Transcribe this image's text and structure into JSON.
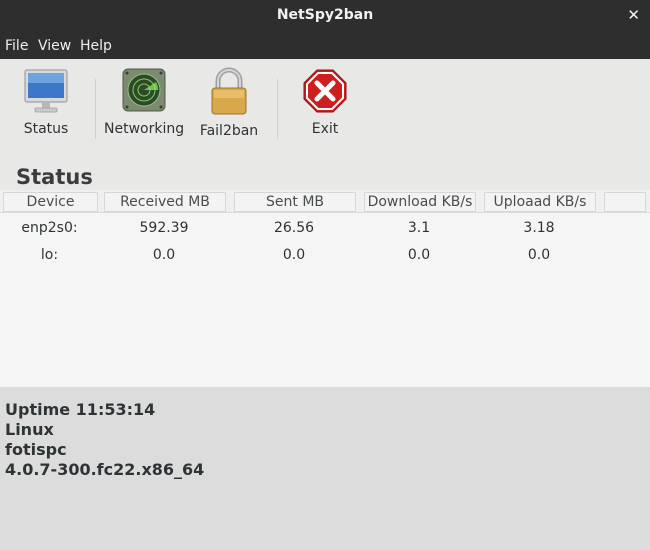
{
  "window": {
    "title": "NetSpy2ban",
    "close_glyph": "✕"
  },
  "menu": [
    "File",
    "View",
    "Help"
  ],
  "toolbar": {
    "status": "Status",
    "networking": "Networking",
    "fail2ban": "Fail2ban",
    "exit": "Exit"
  },
  "section_title": "Status",
  "table": {
    "headers": [
      "Device",
      "Received MB",
      "Sent MB",
      "Download KB/s",
      "Uploaad KB/s",
      ""
    ],
    "rows": [
      [
        "enp2s0:",
        "592.39",
        "26.56",
        "3.1",
        "3.18"
      ],
      [
        "lo:",
        "0.0",
        "0.0",
        "0.0",
        "0.0"
      ]
    ]
  },
  "info": {
    "uptime": "Uptime 11:53:14",
    "os": "Linux",
    "hostname": "fotispc",
    "kernel": "4.0.7-300.fc22.x86_64"
  },
  "colors": {
    "titlebar": "#2e2e2e",
    "exit_red": "#cc1f1f",
    "window_bg": "#e8e8e7"
  },
  "icons": [
    "monitor-icon",
    "radar-icon",
    "padlock-icon",
    "stop-x-icon",
    "close-icon"
  ]
}
